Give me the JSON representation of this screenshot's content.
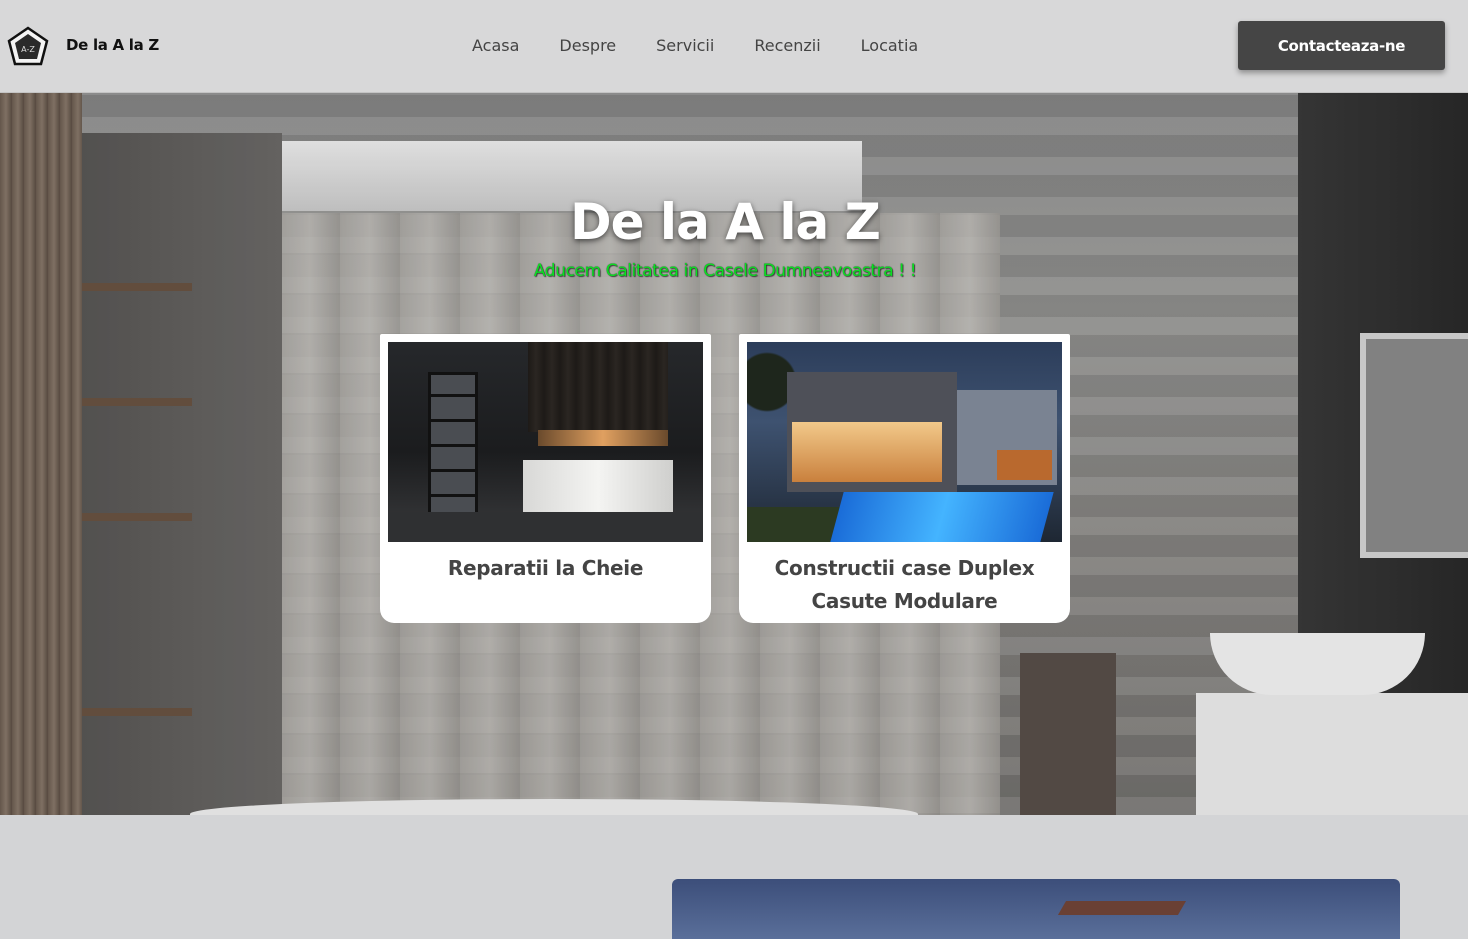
{
  "header": {
    "brand": "De la A la Z",
    "nav": [
      "Acasa",
      "Despre",
      "Servicii",
      "Recenzii",
      "Locatia"
    ],
    "cta_label": "Contacteaza-ne"
  },
  "hero": {
    "title": "De la A la Z",
    "subtitle": "Aducem Calitatea in Casele Dumneavoastra ! !",
    "subtitle_color": "#0adf22"
  },
  "cards": [
    {
      "label": "Reparatii la Cheie"
    },
    {
      "label_line1": "Constructii case Duplex",
      "label_line2": "Casute Modulare"
    }
  ],
  "colors": {
    "header_bg": "#d8d8d9",
    "cta_bg": "#454545",
    "page_bg": "#d3d4d6"
  }
}
